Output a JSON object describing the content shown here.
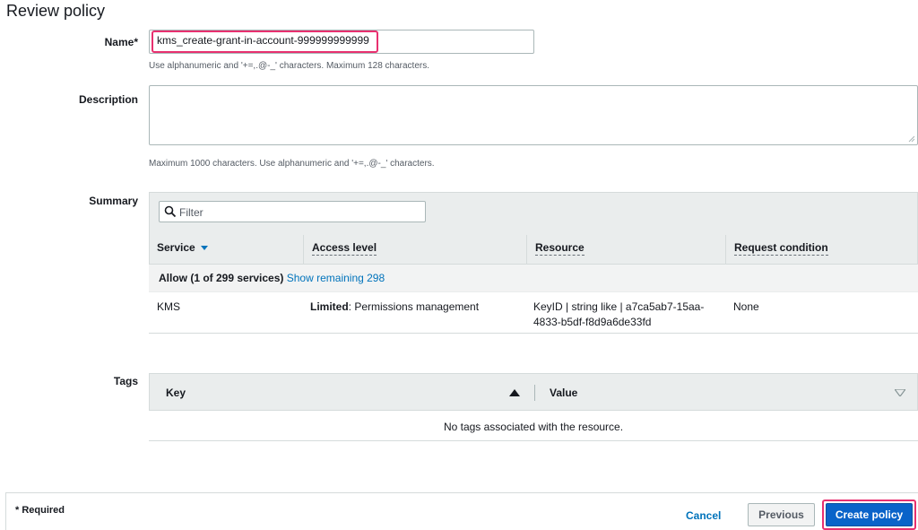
{
  "page": {
    "title": "Review policy"
  },
  "name_field": {
    "label": "Name*",
    "value": "kms_create-grant-in-account-999999999999",
    "help": "Use alphanumeric and '+=,.@-_' characters. Maximum 128 characters."
  },
  "description_field": {
    "label": "Description",
    "value": "",
    "help": "Maximum 1000 characters. Use alphanumeric and '+=,.@-_' characters."
  },
  "summary": {
    "label": "Summary",
    "filter_placeholder": "Filter",
    "columns": [
      "Service",
      "Access level",
      "Resource",
      "Request condition"
    ],
    "allow_text": "Allow (1 of 299 services)",
    "show_remaining": "Show remaining 298",
    "rows": [
      {
        "service": "KMS",
        "access_level_bold": "Limited",
        "access_level_rest": ": Permissions management",
        "resource_line1": "KeyID | string like | a7ca5ab7-15aa-",
        "resource_line2": "4833-b5df-f8d9a6de33fd",
        "request_condition": "None"
      }
    ]
  },
  "tags": {
    "label": "Tags",
    "columns": [
      "Key",
      "Value"
    ],
    "empty_message": "No tags associated with the resource."
  },
  "footer": {
    "required_note": "* Required",
    "cancel_label": "Cancel",
    "previous_label": "Previous",
    "create_label": "Create policy"
  },
  "colors": {
    "primary": "#0a63c9",
    "link": "#0073bb",
    "highlight": "#e8306f"
  },
  "icons": [
    "search-icon",
    "sort-down-caret-icon",
    "sort-up-icon",
    "sort-down-icon",
    "resize-grip-icon"
  ]
}
